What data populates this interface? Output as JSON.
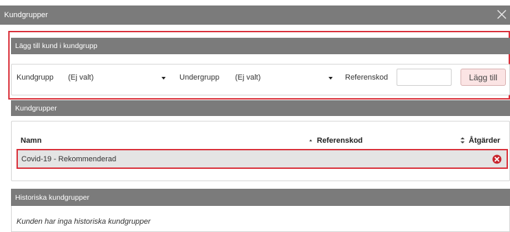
{
  "window": {
    "title": "Kundgrupper"
  },
  "add_section": {
    "header": "Lägg till kund i kundgrupp",
    "kundgrupp_label": "Kundgrupp",
    "kundgrupp_value": "(Ej valt)",
    "undergrupp_label": "Undergrupp",
    "undergrupp_value": "(Ej valt)",
    "referenskod_label": "Referenskod",
    "referenskod_value": "",
    "add_button": "Lägg till"
  },
  "groups_section": {
    "header": "Kundgrupper",
    "columns": {
      "name": "Namn",
      "ref": "Referenskod",
      "actions": "Åtgärder"
    },
    "rows": [
      {
        "name": "Covid-19 - Rekommenderad",
        "ref": ""
      }
    ]
  },
  "history_section": {
    "header": "Historiska kundgrupper",
    "empty_text": "Kunden har inga historiska kundgrupper"
  },
  "icons": {
    "close": "close-icon",
    "delete": "remove-circle-icon",
    "sort": "sort-icon"
  },
  "colors": {
    "header_bg": "#7b7b7b",
    "highlight_border": "#d9303a",
    "delete_icon": "#c8222b",
    "button_bg": "#fbe4e4"
  }
}
